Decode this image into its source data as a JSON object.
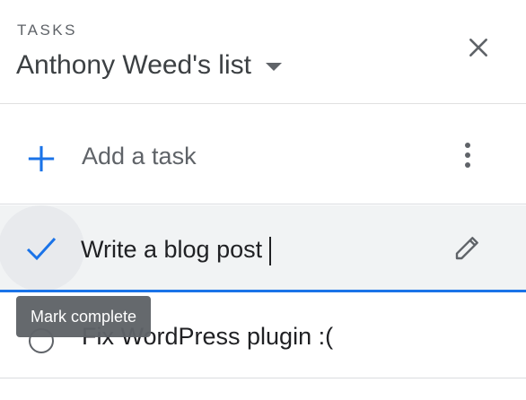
{
  "header": {
    "app_label": "TASKS",
    "list_title": "Anthony Weed's list"
  },
  "add_task": {
    "label": "Add a task"
  },
  "tasks": [
    {
      "title": "Write a blog post",
      "state": "editing"
    },
    {
      "title": "Fix WordPress plugin :(",
      "state": "incomplete"
    }
  ],
  "tooltip": {
    "text": "Mark complete"
  },
  "icons": {
    "caret": "caret-down-icon",
    "close": "close-icon",
    "add": "plus-icon",
    "more": "more-vertical-icon",
    "check": "check-icon",
    "edit": "pencil-icon",
    "radio": "circle-outline-icon"
  },
  "colors": {
    "accent": "#1a73e8",
    "text": "#3c4043",
    "secondary_text": "#5f6368",
    "tooltip_bg": "#5f6368",
    "active_row_bg": "#f1f3f4"
  }
}
